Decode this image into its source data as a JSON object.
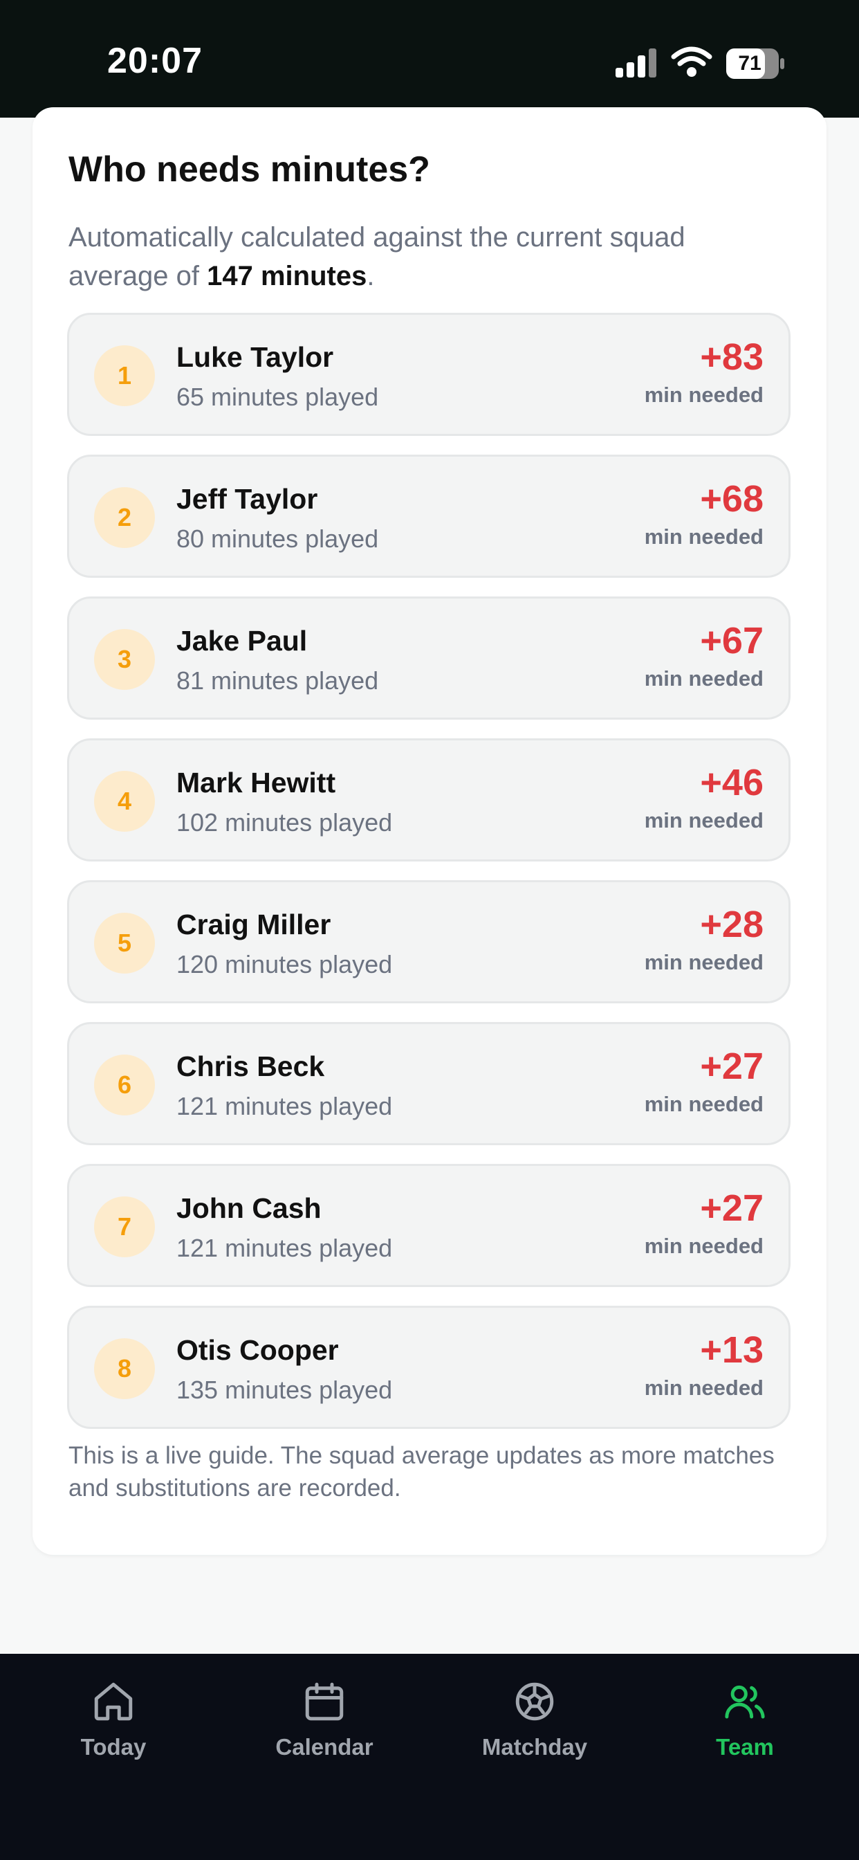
{
  "status_bar": {
    "time": "20:07",
    "battery": "71"
  },
  "card": {
    "title": "Who needs minutes?",
    "desc_prefix": "Automatically calculated against the current squad average of ",
    "desc_value": "147 minutes",
    "desc_suffix": ".",
    "players": [
      {
        "rank": "1",
        "name": "Luke Taylor",
        "played": "65 minutes played",
        "needed": "+83",
        "needed_label": "min needed"
      },
      {
        "rank": "2",
        "name": "Jeff Taylor",
        "played": "80 minutes played",
        "needed": "+68",
        "needed_label": "min needed"
      },
      {
        "rank": "3",
        "name": "Jake Paul",
        "played": "81 minutes played",
        "needed": "+67",
        "needed_label": "min needed"
      },
      {
        "rank": "4",
        "name": "Mark Hewitt",
        "played": "102 minutes played",
        "needed": "+46",
        "needed_label": "min needed"
      },
      {
        "rank": "5",
        "name": "Craig Miller",
        "played": "120 minutes played",
        "needed": "+28",
        "needed_label": "min needed"
      },
      {
        "rank": "6",
        "name": "Chris Beck",
        "played": "121 minutes played",
        "needed": "+27",
        "needed_label": "min needed"
      },
      {
        "rank": "7",
        "name": "John Cash",
        "played": "121 minutes played",
        "needed": "+27",
        "needed_label": "min needed"
      },
      {
        "rank": "8",
        "name": "Otis Cooper",
        "played": "135 minutes played",
        "needed": "+13",
        "needed_label": "min needed"
      }
    ],
    "footnote": "This is a live guide. The squad average updates as more matches and substitutions are recorded."
  },
  "tab_bar": {
    "tabs": [
      {
        "label": "Today",
        "icon": "home-icon"
      },
      {
        "label": "Calendar",
        "icon": "calendar-icon"
      },
      {
        "label": "Matchday",
        "icon": "football-icon"
      },
      {
        "label": "Team",
        "icon": "team-icon",
        "active": true
      }
    ]
  },
  "colors": {
    "accent": "#22c55e",
    "needed": "#e0393e",
    "rank": "#f59e0b"
  }
}
